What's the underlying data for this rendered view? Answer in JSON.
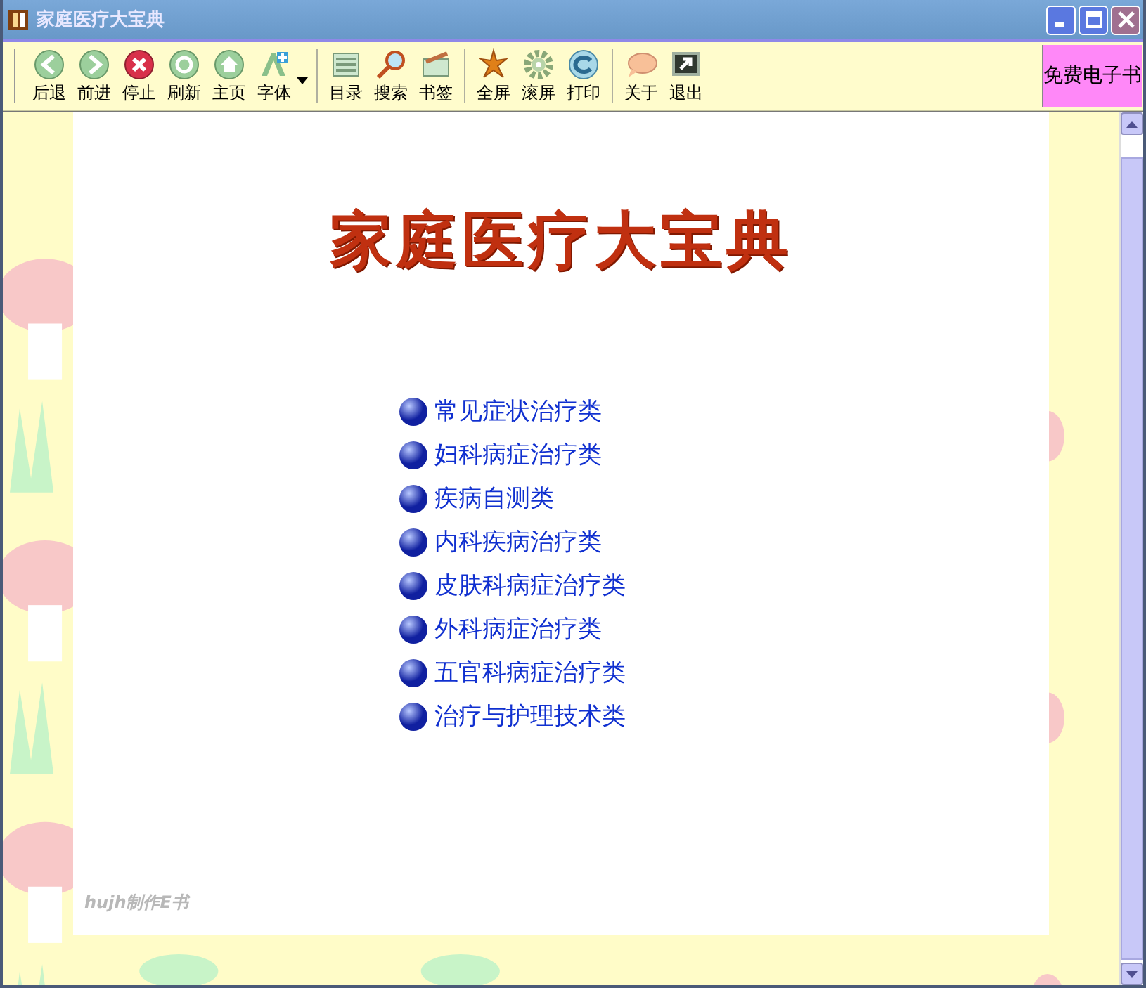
{
  "window": {
    "title": "家庭医疗大宝典"
  },
  "toolbar": {
    "groups": [
      [
        {
          "label": "后退"
        },
        {
          "label": "前进"
        },
        {
          "label": "停止"
        },
        {
          "label": "刷新"
        },
        {
          "label": "主页"
        },
        {
          "label": "字体",
          "dropdown": true
        }
      ],
      [
        {
          "label": "目录"
        },
        {
          "label": "搜索"
        },
        {
          "label": "书签"
        }
      ],
      [
        {
          "label": "全屏"
        },
        {
          "label": "滚屏"
        },
        {
          "label": "打印"
        }
      ],
      [
        {
          "label": "关于"
        },
        {
          "label": "退出"
        }
      ]
    ],
    "badge": "免费电子书"
  },
  "page": {
    "heading": "家庭医疗大宝典",
    "links": [
      "常见症状治疗类",
      "妇科病症治疗类",
      "疾病自测类",
      "内科疾病治疗类",
      "皮肤科病症治疗类",
      "外科病症治疗类",
      "五官科病症治疗类",
      "治疗与护理技术类"
    ],
    "footer": "hujh制作E书"
  }
}
